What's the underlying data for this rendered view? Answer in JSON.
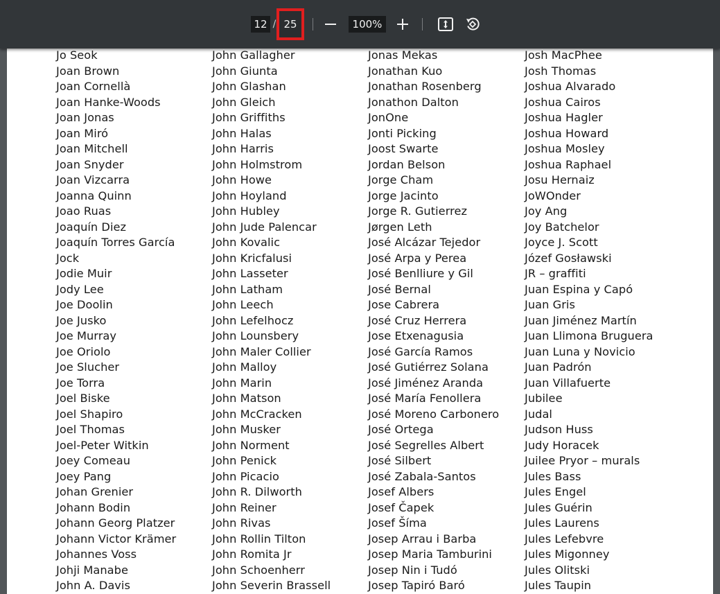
{
  "toolbar": {
    "page_current": "12",
    "page_separator": "/",
    "page_total": "25",
    "zoom_level": "100%",
    "icons": {
      "zoom_out": "minus-icon",
      "zoom_in": "plus-icon",
      "fit": "fit-to-page-icon",
      "rotate": "rotate-icon"
    },
    "highlight_color": "#e01f1f"
  },
  "document": {
    "columns": [
      [
        "Jo Seok",
        "Joan Brown",
        "Joan Cornellà",
        "Joan Hanke-Woods",
        "Joan Jonas",
        "Joan Miró",
        "Joan Mitchell",
        "Joan Snyder",
        "Joan Vizcarra",
        "Joanna Quinn",
        "Joao Ruas",
        "Joaquín Diez",
        "Joaquín Torres García",
        "Jock",
        "Jodie Muir",
        "Jody Lee",
        "Joe Doolin",
        "Joe Jusko",
        "Joe Murray",
        "Joe Oriolo",
        "Joe Slucher",
        "Joe Torra",
        "Joel Biske",
        "Joel Shapiro",
        "Joel Thomas",
        "Joel-Peter Witkin",
        "Joey Comeau",
        "Joey Pang",
        "Johan Grenier",
        "Johann Bodin",
        "Johann Georg Platzer",
        "Johann Victor Krämer",
        "Johannes Voss",
        "Johji Manabe",
        "John A. Davis"
      ],
      [
        "John Gallagher",
        "John Giunta",
        "John Glashan",
        "John Gleich",
        "John Griffiths",
        "John Halas",
        "John Harris",
        "John Holmstrom",
        "John Howe",
        "John Hoyland",
        "John Hubley",
        "John Jude Palencar",
        "John Kovalic",
        "John Kricfalusi",
        "John Lasseter",
        "John Latham",
        "John Leech",
        "John Lefelhocz",
        "John Lounsbery",
        "John Maler Collier",
        "John Malloy",
        "John Marin",
        "John Matson",
        "John McCracken",
        "John Musker",
        "John Norment",
        "John Penick",
        "John Picacio",
        "John R. Dilworth",
        "John Reiner",
        "John Rivas",
        "John Rollin Tilton",
        "John Romita Jr",
        "John Schoenherr",
        "John Severin Brassell"
      ],
      [
        "Jonas Mekas",
        "Jonathan Kuo",
        "Jonathan Rosenberg",
        "Jonathon Dalton",
        "JonOne",
        "Jonti Picking",
        "Joost Swarte",
        "Jordan Belson",
        "Jorge Cham",
        "Jorge Jacinto",
        "Jorge R. Gutierrez",
        "Jørgen Leth",
        "José Alcázar Tejedor",
        "José Arpa y Perea",
        "José Benlliure y Gil",
        "José Bernal",
        "Jose Cabrera",
        "José Cruz Herrera",
        "Jose Etxenagusia",
        "José García Ramos",
        "José Gutiérrez Solana",
        "José Jiménez Aranda",
        "José María Fenollera",
        "José Moreno Carbonero",
        "José Ortega",
        "José Segrelles Albert",
        "José Silbert",
        "José Zabala-Santos",
        "Josef Albers",
        "Josef Čapek",
        "Josef Šíma",
        "Josep Arrau i Barba",
        "Josep Maria Tamburini",
        "Josep Nin i Tudó",
        "Josep Tapiró Baró"
      ],
      [
        "Josh MacPhee",
        "Josh Thomas",
        "Joshua Alvarado",
        "Joshua Cairos",
        "Joshua Hagler",
        "Joshua Howard",
        "Joshua Mosley",
        "Joshua Raphael",
        "Josu Hernaiz",
        "JoWOnder",
        "Joy Ang",
        "Joy Batchelor",
        "Joyce J. Scott",
        "Józef Gosławski",
        "JR – graffiti",
        "Juan Espina y Capó",
        "Juan Gris",
        "Juan Jiménez Martín",
        "Juan Llimona Bruguera",
        "Juan Luna y Novicio",
        "Juan Padrón",
        "Juan Villafuerte",
        "Jubilee",
        "Judal",
        "Judson Huss",
        "Judy Horacek",
        "Juilee Pryor – murals",
        "Jules Bass",
        "Jules Engel",
        "Jules Guérin",
        "Jules Laurens",
        "Jules Lefebvre",
        "Jules Migonney",
        "Jules Olitski",
        "Jules Taupin"
      ]
    ]
  }
}
